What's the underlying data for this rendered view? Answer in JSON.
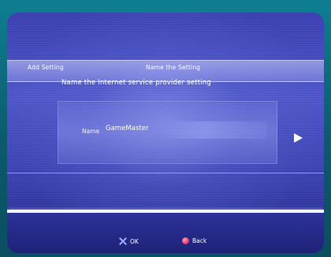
{
  "header": {
    "breadcrumb_left": "Add Setting",
    "breadcrumb_right": "Name the Setting"
  },
  "prompt": "Name the Internet service provider setting",
  "field": {
    "label": "Name",
    "value": "GameMaster"
  },
  "footer": {
    "ok_label": "OK",
    "back_label": "Back",
    "ok_icon": "cross-icon",
    "back_icon": "circle-icon"
  },
  "colors": {
    "background": "#3a3fb0",
    "bezel": "#0f7e92",
    "ok_icon": "#9aa8ff",
    "back_icon": "#e0305f"
  }
}
